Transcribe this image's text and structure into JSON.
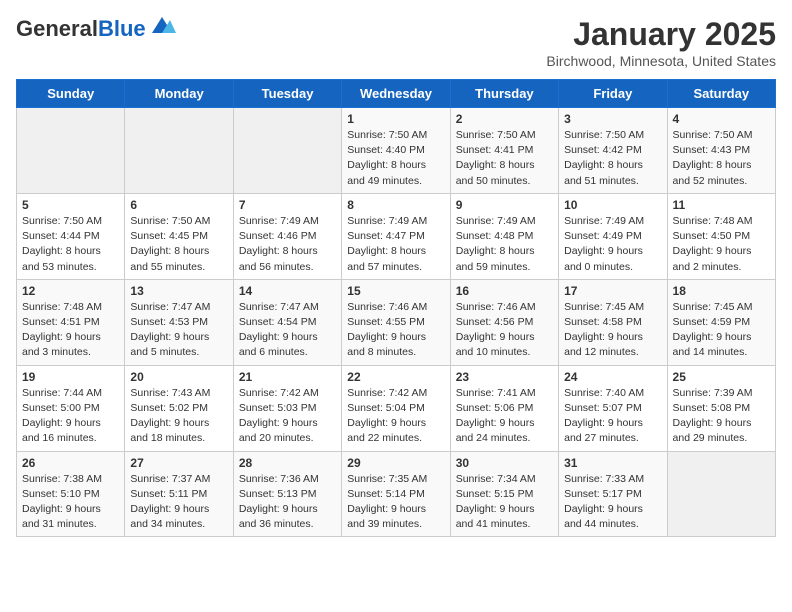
{
  "header": {
    "logo_general": "General",
    "logo_blue": "Blue",
    "month": "January 2025",
    "location": "Birchwood, Minnesota, United States"
  },
  "days_of_week": [
    "Sunday",
    "Monday",
    "Tuesday",
    "Wednesday",
    "Thursday",
    "Friday",
    "Saturday"
  ],
  "weeks": [
    [
      {
        "day": "",
        "sunrise": "",
        "sunset": "",
        "daylight": ""
      },
      {
        "day": "",
        "sunrise": "",
        "sunset": "",
        "daylight": ""
      },
      {
        "day": "",
        "sunrise": "",
        "sunset": "",
        "daylight": ""
      },
      {
        "day": "1",
        "sunrise": "Sunrise: 7:50 AM",
        "sunset": "Sunset: 4:40 PM",
        "daylight": "Daylight: 8 hours and 49 minutes."
      },
      {
        "day": "2",
        "sunrise": "Sunrise: 7:50 AM",
        "sunset": "Sunset: 4:41 PM",
        "daylight": "Daylight: 8 hours and 50 minutes."
      },
      {
        "day": "3",
        "sunrise": "Sunrise: 7:50 AM",
        "sunset": "Sunset: 4:42 PM",
        "daylight": "Daylight: 8 hours and 51 minutes."
      },
      {
        "day": "4",
        "sunrise": "Sunrise: 7:50 AM",
        "sunset": "Sunset: 4:43 PM",
        "daylight": "Daylight: 8 hours and 52 minutes."
      }
    ],
    [
      {
        "day": "5",
        "sunrise": "Sunrise: 7:50 AM",
        "sunset": "Sunset: 4:44 PM",
        "daylight": "Daylight: 8 hours and 53 minutes."
      },
      {
        "day": "6",
        "sunrise": "Sunrise: 7:50 AM",
        "sunset": "Sunset: 4:45 PM",
        "daylight": "Daylight: 8 hours and 55 minutes."
      },
      {
        "day": "7",
        "sunrise": "Sunrise: 7:49 AM",
        "sunset": "Sunset: 4:46 PM",
        "daylight": "Daylight: 8 hours and 56 minutes."
      },
      {
        "day": "8",
        "sunrise": "Sunrise: 7:49 AM",
        "sunset": "Sunset: 4:47 PM",
        "daylight": "Daylight: 8 hours and 57 minutes."
      },
      {
        "day": "9",
        "sunrise": "Sunrise: 7:49 AM",
        "sunset": "Sunset: 4:48 PM",
        "daylight": "Daylight: 8 hours and 59 minutes."
      },
      {
        "day": "10",
        "sunrise": "Sunrise: 7:49 AM",
        "sunset": "Sunset: 4:49 PM",
        "daylight": "Daylight: 9 hours and 0 minutes."
      },
      {
        "day": "11",
        "sunrise": "Sunrise: 7:48 AM",
        "sunset": "Sunset: 4:50 PM",
        "daylight": "Daylight: 9 hours and 2 minutes."
      }
    ],
    [
      {
        "day": "12",
        "sunrise": "Sunrise: 7:48 AM",
        "sunset": "Sunset: 4:51 PM",
        "daylight": "Daylight: 9 hours and 3 minutes."
      },
      {
        "day": "13",
        "sunrise": "Sunrise: 7:47 AM",
        "sunset": "Sunset: 4:53 PM",
        "daylight": "Daylight: 9 hours and 5 minutes."
      },
      {
        "day": "14",
        "sunrise": "Sunrise: 7:47 AM",
        "sunset": "Sunset: 4:54 PM",
        "daylight": "Daylight: 9 hours and 6 minutes."
      },
      {
        "day": "15",
        "sunrise": "Sunrise: 7:46 AM",
        "sunset": "Sunset: 4:55 PM",
        "daylight": "Daylight: 9 hours and 8 minutes."
      },
      {
        "day": "16",
        "sunrise": "Sunrise: 7:46 AM",
        "sunset": "Sunset: 4:56 PM",
        "daylight": "Daylight: 9 hours and 10 minutes."
      },
      {
        "day": "17",
        "sunrise": "Sunrise: 7:45 AM",
        "sunset": "Sunset: 4:58 PM",
        "daylight": "Daylight: 9 hours and 12 minutes."
      },
      {
        "day": "18",
        "sunrise": "Sunrise: 7:45 AM",
        "sunset": "Sunset: 4:59 PM",
        "daylight": "Daylight: 9 hours and 14 minutes."
      }
    ],
    [
      {
        "day": "19",
        "sunrise": "Sunrise: 7:44 AM",
        "sunset": "Sunset: 5:00 PM",
        "daylight": "Daylight: 9 hours and 16 minutes."
      },
      {
        "day": "20",
        "sunrise": "Sunrise: 7:43 AM",
        "sunset": "Sunset: 5:02 PM",
        "daylight": "Daylight: 9 hours and 18 minutes."
      },
      {
        "day": "21",
        "sunrise": "Sunrise: 7:42 AM",
        "sunset": "Sunset: 5:03 PM",
        "daylight": "Daylight: 9 hours and 20 minutes."
      },
      {
        "day": "22",
        "sunrise": "Sunrise: 7:42 AM",
        "sunset": "Sunset: 5:04 PM",
        "daylight": "Daylight: 9 hours and 22 minutes."
      },
      {
        "day": "23",
        "sunrise": "Sunrise: 7:41 AM",
        "sunset": "Sunset: 5:06 PM",
        "daylight": "Daylight: 9 hours and 24 minutes."
      },
      {
        "day": "24",
        "sunrise": "Sunrise: 7:40 AM",
        "sunset": "Sunset: 5:07 PM",
        "daylight": "Daylight: 9 hours and 27 minutes."
      },
      {
        "day": "25",
        "sunrise": "Sunrise: 7:39 AM",
        "sunset": "Sunset: 5:08 PM",
        "daylight": "Daylight: 9 hours and 29 minutes."
      }
    ],
    [
      {
        "day": "26",
        "sunrise": "Sunrise: 7:38 AM",
        "sunset": "Sunset: 5:10 PM",
        "daylight": "Daylight: 9 hours and 31 minutes."
      },
      {
        "day": "27",
        "sunrise": "Sunrise: 7:37 AM",
        "sunset": "Sunset: 5:11 PM",
        "daylight": "Daylight: 9 hours and 34 minutes."
      },
      {
        "day": "28",
        "sunrise": "Sunrise: 7:36 AM",
        "sunset": "Sunset: 5:13 PM",
        "daylight": "Daylight: 9 hours and 36 minutes."
      },
      {
        "day": "29",
        "sunrise": "Sunrise: 7:35 AM",
        "sunset": "Sunset: 5:14 PM",
        "daylight": "Daylight: 9 hours and 39 minutes."
      },
      {
        "day": "30",
        "sunrise": "Sunrise: 7:34 AM",
        "sunset": "Sunset: 5:15 PM",
        "daylight": "Daylight: 9 hours and 41 minutes."
      },
      {
        "day": "31",
        "sunrise": "Sunrise: 7:33 AM",
        "sunset": "Sunset: 5:17 PM",
        "daylight": "Daylight: 9 hours and 44 minutes."
      },
      {
        "day": "",
        "sunrise": "",
        "sunset": "",
        "daylight": ""
      }
    ]
  ]
}
